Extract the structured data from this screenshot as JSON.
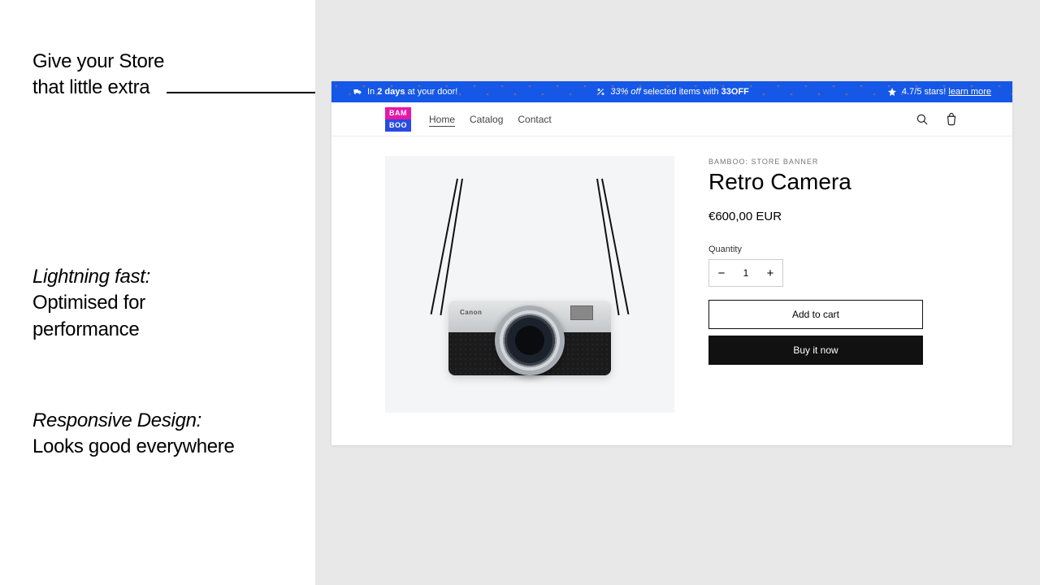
{
  "features": {
    "f1": {
      "line1": "Give your Store",
      "line2": "that little extra"
    },
    "f2": {
      "lead": "Lightning fast:",
      "line1": "Optimised for",
      "line2": "performance"
    },
    "f3": {
      "lead": "Responsive Design:",
      "line1": "Looks good everywhere"
    }
  },
  "promo": {
    "ship_pre": "In ",
    "ship_bold": "2 days",
    "ship_post": " at your door!",
    "sale_pre": "33% off ",
    "sale_mid": "selected items with ",
    "sale_code": "33OFF",
    "rating_text": "4.7/5 stars! ",
    "rating_link": "learn more"
  },
  "store": {
    "logo_top": "BAM",
    "logo_bot": "BOO",
    "nav": {
      "home": "Home",
      "catalog": "Catalog",
      "contact": "Contact"
    }
  },
  "product": {
    "vendor": "BAMBOO: STORE BANNER",
    "title": "Retro Camera",
    "price": "€600,00 EUR",
    "qty_label": "Quantity",
    "qty_value": "1",
    "minus": "−",
    "plus": "+",
    "add": "Add to cart",
    "buy": "Buy it now",
    "camera_brand": "Canon"
  }
}
